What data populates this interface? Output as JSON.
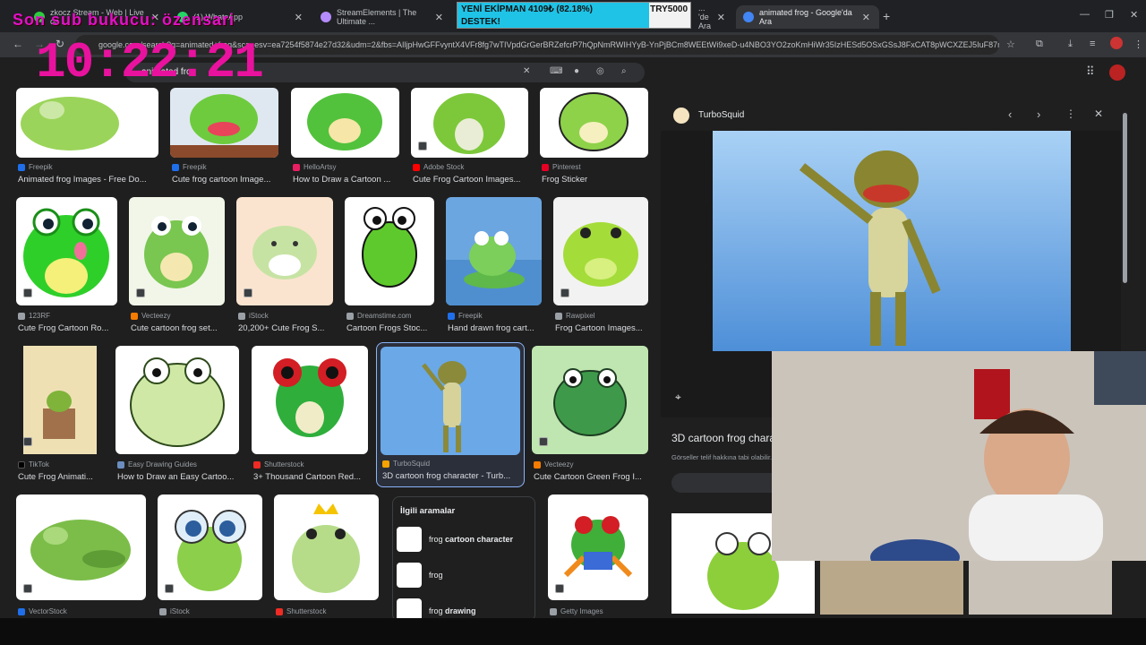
{
  "tabs": [
    {
      "label": "zkocz Stream - Web | Live on ...",
      "color": "#2ecc40"
    },
    {
      "label": "(1) WhatsApp",
      "color": "#25d366"
    },
    {
      "label": "StreamElements | The Ultimate ...",
      "color": "#b58bff"
    },
    {
      "label": "... 'de Ara",
      "color": "#4285f4"
    },
    {
      "label": "animated frog - Google'da Ara",
      "color": "#4285f4"
    }
  ],
  "url": "google.com/search?q=animated+frog&sca_esv=ea7254f5874e27d32&udm=2&fbs=AIljpHwGFFvyntX4VFr8fg7wTIVpdGrGerBRZefcrP7hQpNmRWIHYyB-YnPjBCm8WEEtWi9xeD-u4NBO3YO2zoKmHiWr35IzHESd5OSxGSsJ8FxCAT8pWCXZEJ5IuF87mW44ESEDyX6fH...",
  "search_query": "animated frog",
  "overlay": {
    "title": "Son sub bukucu: özensari",
    "clock": "10:22:21"
  },
  "goal": {
    "line1": "YENİ EKİPMAN 4109₺ (82.18%)",
    "line2": "DESTEK!",
    "target": "TRY5000",
    "progress": 0.8218
  },
  "results": {
    "row1": [
      {
        "source": "Freepik",
        "title": "Animated frog Images - Free Do...",
        "fav": "#1f6feb"
      },
      {
        "source": "Freepik",
        "title": "Cute frog cartoon Image...",
        "fav": "#1f6feb"
      },
      {
        "source": "HelloArtsy",
        "title": "How to Draw a Cartoon ...",
        "fav": "#e91e63"
      },
      {
        "source": "Adobe Stock",
        "title": "Cute Frog Cartoon Images...",
        "fav": "#ff0000"
      },
      {
        "source": "Pinterest",
        "title": "Frog Sticker",
        "fav": "#e60023"
      }
    ],
    "row2": [
      {
        "source": "123RF",
        "title": "Cute Frog Cartoon Ro...",
        "fav": "#9aa0a6"
      },
      {
        "source": "Vecteezy",
        "title": "Cute cartoon frog set...",
        "fav": "#f57c00"
      },
      {
        "source": "iStock",
        "title": "20,200+ Cute Frog S...",
        "fav": "#9aa0a6"
      },
      {
        "source": "Dreamstime.com",
        "title": "Cartoon Frogs Stoc...",
        "fav": "#9aa0a6"
      },
      {
        "source": "Freepik",
        "title": "Hand drawn frog cart...",
        "fav": "#1f6feb"
      },
      {
        "source": "Rawpixel",
        "title": "Frog Cartoon Images...",
        "fav": "#9aa0a6"
      }
    ],
    "row3": [
      {
        "source": "TikTok",
        "title": "Cute Frog Animati...",
        "fav": "#000000"
      },
      {
        "source": "Easy Drawing Guides",
        "title": "How to Draw an Easy Cartoo...",
        "fav": "#6c8ebf"
      },
      {
        "source": "Shutterstock",
        "title": "3+ Thousand Cartoon Red...",
        "fav": "#ee2b24"
      },
      {
        "source": "TurboSquid",
        "title": "3D cartoon frog character - Turb...",
        "fav": "#f4a300"
      },
      {
        "source": "Vecteezy",
        "title": "Cute Cartoon Green Frog I...",
        "fav": "#f57c00"
      }
    ],
    "row4": [
      {
        "source": "VectorStock",
        "title": "",
        "fav": "#1f6feb"
      },
      {
        "source": "iStock",
        "title": "",
        "fav": "#9aa0a6"
      },
      {
        "source": "Shutterstock",
        "title": "",
        "fav": "#ee2b24"
      },
      {
        "source": "Getty Images",
        "title": "",
        "fav": "#9aa0a6"
      }
    ]
  },
  "related": {
    "heading": "İlgili aramalar",
    "items": [
      {
        "prefix": "frog ",
        "bold": "cartoon character"
      },
      {
        "prefix": "frog",
        "bold": ""
      },
      {
        "prefix": "frog ",
        "bold": "drawing"
      }
    ]
  },
  "panel": {
    "source": "TurboSquid",
    "title": "3D cartoon frog character - TurboSquid",
    "notice": "Görseller telif hakkına tabi olabilir."
  }
}
